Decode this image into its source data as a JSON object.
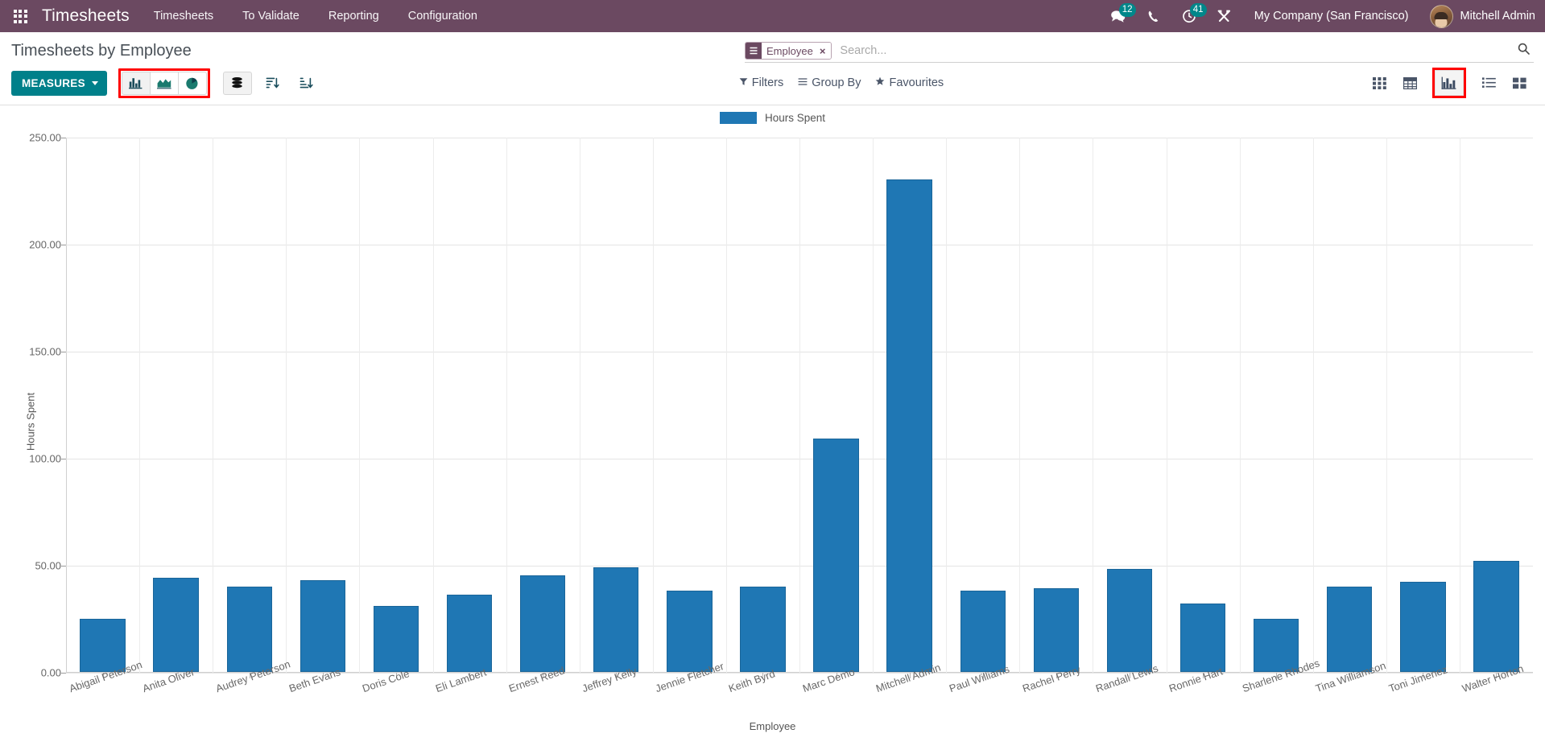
{
  "navbar": {
    "apps_icon": "apps-grid-icon",
    "brand": "Timesheets",
    "menus": [
      {
        "label": "Timesheets"
      },
      {
        "label": "To Validate"
      },
      {
        "label": "Reporting"
      },
      {
        "label": "Configuration"
      }
    ],
    "messages_icon": "messages-icon",
    "messages_count": "12",
    "phone_icon": "phone-icon",
    "activity_icon": "activity-clock-icon",
    "activity_count": "41",
    "tools_icon": "crossed-tools-icon",
    "company": "My Company (San Francisco)",
    "avatar_icon": "user-avatar",
    "user": "Mitchell Admin",
    "background_color": "#6b4961",
    "badge_color": "#00878a"
  },
  "control_panel": {
    "breadcrumb": "Timesheets by Employee",
    "search": {
      "facet_icon": "group-by-icon",
      "facet_label": "Employee",
      "facet_close": "×",
      "placeholder": "Search...",
      "value": "",
      "search_icon": "search-icon"
    },
    "measures_label": "MEASURES",
    "chart_buttons": [
      {
        "name": "bar-chart-button",
        "title": "Bar Chart",
        "active": true
      },
      {
        "name": "line-chart-button",
        "title": "Line Chart",
        "active": false
      },
      {
        "name": "pie-chart-button",
        "title": "Pie Chart",
        "active": false
      }
    ],
    "stacked_button_title": "Stacked",
    "sort_desc_title": "Descending",
    "sort_asc_title": "Ascending",
    "filters_label": "Filters",
    "groupby_label": "Group By",
    "favourites_label": "Favourites",
    "views": [
      {
        "name": "kanban-view-button",
        "title": "Kanban",
        "active": false
      },
      {
        "name": "pivot-view-button",
        "title": "Pivot",
        "active": false
      },
      {
        "name": "graph-view-button",
        "title": "Graph",
        "active": true
      },
      {
        "name": "list-view-button",
        "title": "List",
        "active": false
      },
      {
        "name": "grid-view-button",
        "title": "Grid",
        "active": false
      }
    ],
    "accent_color": "#00808a",
    "highlight_color": "#ff0000"
  },
  "chart_data": {
    "type": "bar",
    "title": "",
    "legend": [
      "Hours Spent"
    ],
    "legend_position": "top",
    "series_color": "#1f77b4",
    "xlabel": "Employee",
    "ylabel": "Hours Spent",
    "ylim": [
      0,
      250
    ],
    "yticks": [
      0,
      50,
      100,
      150,
      200,
      250
    ],
    "ytick_labels": [
      "0.00",
      "50.00",
      "100.00",
      "150.00",
      "200.00",
      "250.00"
    ],
    "grid": true,
    "categories": [
      "Abigail Peterson",
      "Anita Oliver",
      "Audrey Peterson",
      "Beth Evans",
      "Doris Cole",
      "Eli Lambert",
      "Ernest Reed",
      "Jeffrey Kelly",
      "Jennie Fletcher",
      "Keith Byrd",
      "Marc Demo",
      "Mitchell Admin",
      "Paul Williams",
      "Rachel Perry",
      "Randall Lewis",
      "Ronnie Hart",
      "Sharlene Rhodes",
      "Tina Williamson",
      "Toni Jimenez",
      "Walter Horton"
    ],
    "series": [
      {
        "name": "Hours Spent",
        "values": [
          25,
          44,
          40,
          43,
          31,
          36,
          45,
          49,
          38,
          40,
          109,
          230,
          38,
          39,
          48,
          32,
          25,
          40,
          42,
          52
        ]
      }
    ]
  }
}
